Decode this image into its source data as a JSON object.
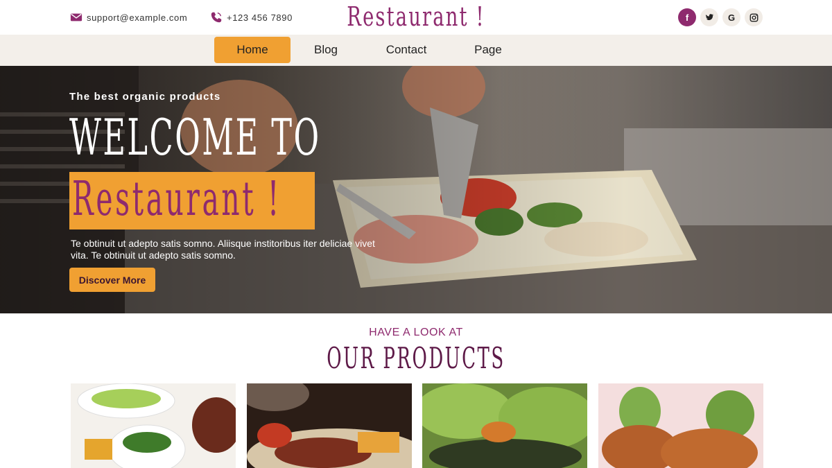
{
  "header": {
    "email": "support@example.com",
    "phone": "+123 456 7890",
    "brand": "Restaurant !",
    "socials": [
      {
        "label": "f",
        "icon": "facebook-icon"
      },
      {
        "label": "t",
        "icon": "twitter-icon"
      },
      {
        "label": "G",
        "icon": "google-icon"
      },
      {
        "label": "◎",
        "icon": "instagram-icon"
      }
    ]
  },
  "nav": {
    "items": [
      "Home",
      "Blog",
      "Contact",
      "Page"
    ],
    "active": "Home"
  },
  "hero": {
    "kicker": "The best organic products",
    "title": "WELCOME TO",
    "brand": "Restaurant !",
    "description": "Te obtinuit ut adepto satis somno. Aliisque institoribus iter deliciae vivet vita. Te obtinuit ut adepto satis somno.",
    "button": "Discover More"
  },
  "products": {
    "kicker": "HAVE A LOOK AT",
    "title": "OUR PRODUCTS"
  },
  "colors": {
    "accent": "#f0a032",
    "brand": "#8e2a6e",
    "nav_bg": "#f3efea"
  }
}
